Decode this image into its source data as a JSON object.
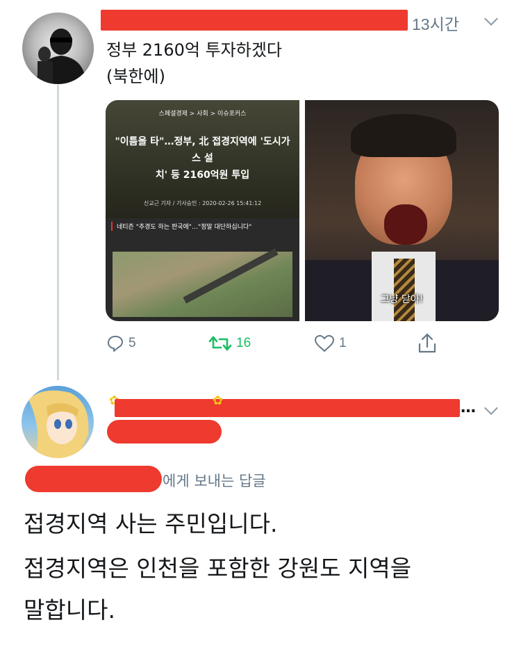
{
  "tweet1": {
    "time": "13시간",
    "text_line1": "정부 2160억 투자하겠다",
    "text_line2": "(북한에)",
    "media_left": {
      "breadcrumb": "스페셜경제 > 사회 > 이슈포커스",
      "headline_line1": "\"이틈을 타\"…정부, 北 접경지역에 '도시가스 설",
      "headline_line2": "치' 등 2160억원 투입",
      "byline": "신교근 기자 / 기사승인 : 2020-02-26 15:41:12",
      "subheadline": "네티즌 \"추경도 하는 판국에\"…\"정말 대단하십니다\""
    },
    "media_right": {
      "subtitle": "그냥 닫아!"
    },
    "actions": {
      "reply_count": "5",
      "retweet_count": "16",
      "like_count": "1"
    }
  },
  "tweet2": {
    "reply_to_suffix": "에게 보내는 답글",
    "body_line1": "접경지역 사는 주민입니다.",
    "body_line2": "접경지역은 인천을 포함한 강원도 지역을",
    "body_line3": "말합니다."
  },
  "colors": {
    "redaction": "#ee3a2f",
    "retweet_green": "#17bf63",
    "meta_gray": "#657786",
    "thread_line": "#cfd9de"
  }
}
